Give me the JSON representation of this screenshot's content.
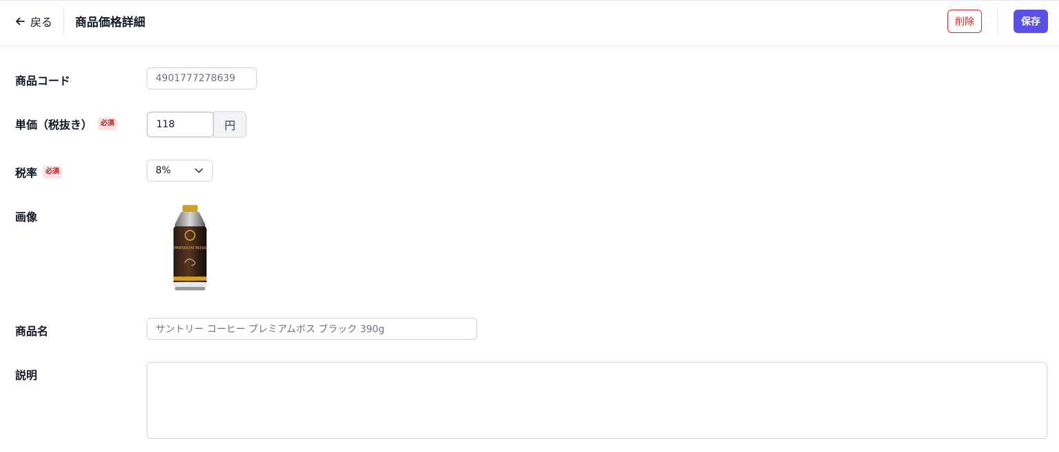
{
  "header": {
    "back_label": "戻る",
    "title": "商品価格詳細",
    "delete_label": "削除",
    "save_label": "保存"
  },
  "form": {
    "code": {
      "label": "商品コード",
      "value": "4901777278639"
    },
    "price": {
      "label": "単価（税抜き）",
      "required_badge": "必須",
      "value": "118",
      "unit": "円"
    },
    "tax": {
      "label": "税率",
      "required_badge": "必須",
      "value": "8%"
    },
    "image": {
      "label": "画像",
      "product_text": "PREMIUM BOSS"
    },
    "name": {
      "label": "商品名",
      "placeholder": "サントリー コーヒー プレミアムボス ブラック 390g"
    },
    "description": {
      "label": "説明",
      "value": ""
    }
  },
  "colors": {
    "primary": "#5b50e6",
    "danger": "#dc2626",
    "required_bg": "#fde2e2",
    "border": "#d1d5db"
  },
  "icons": {
    "back": "arrow-left-icon",
    "select": "chevron-down-icon"
  }
}
